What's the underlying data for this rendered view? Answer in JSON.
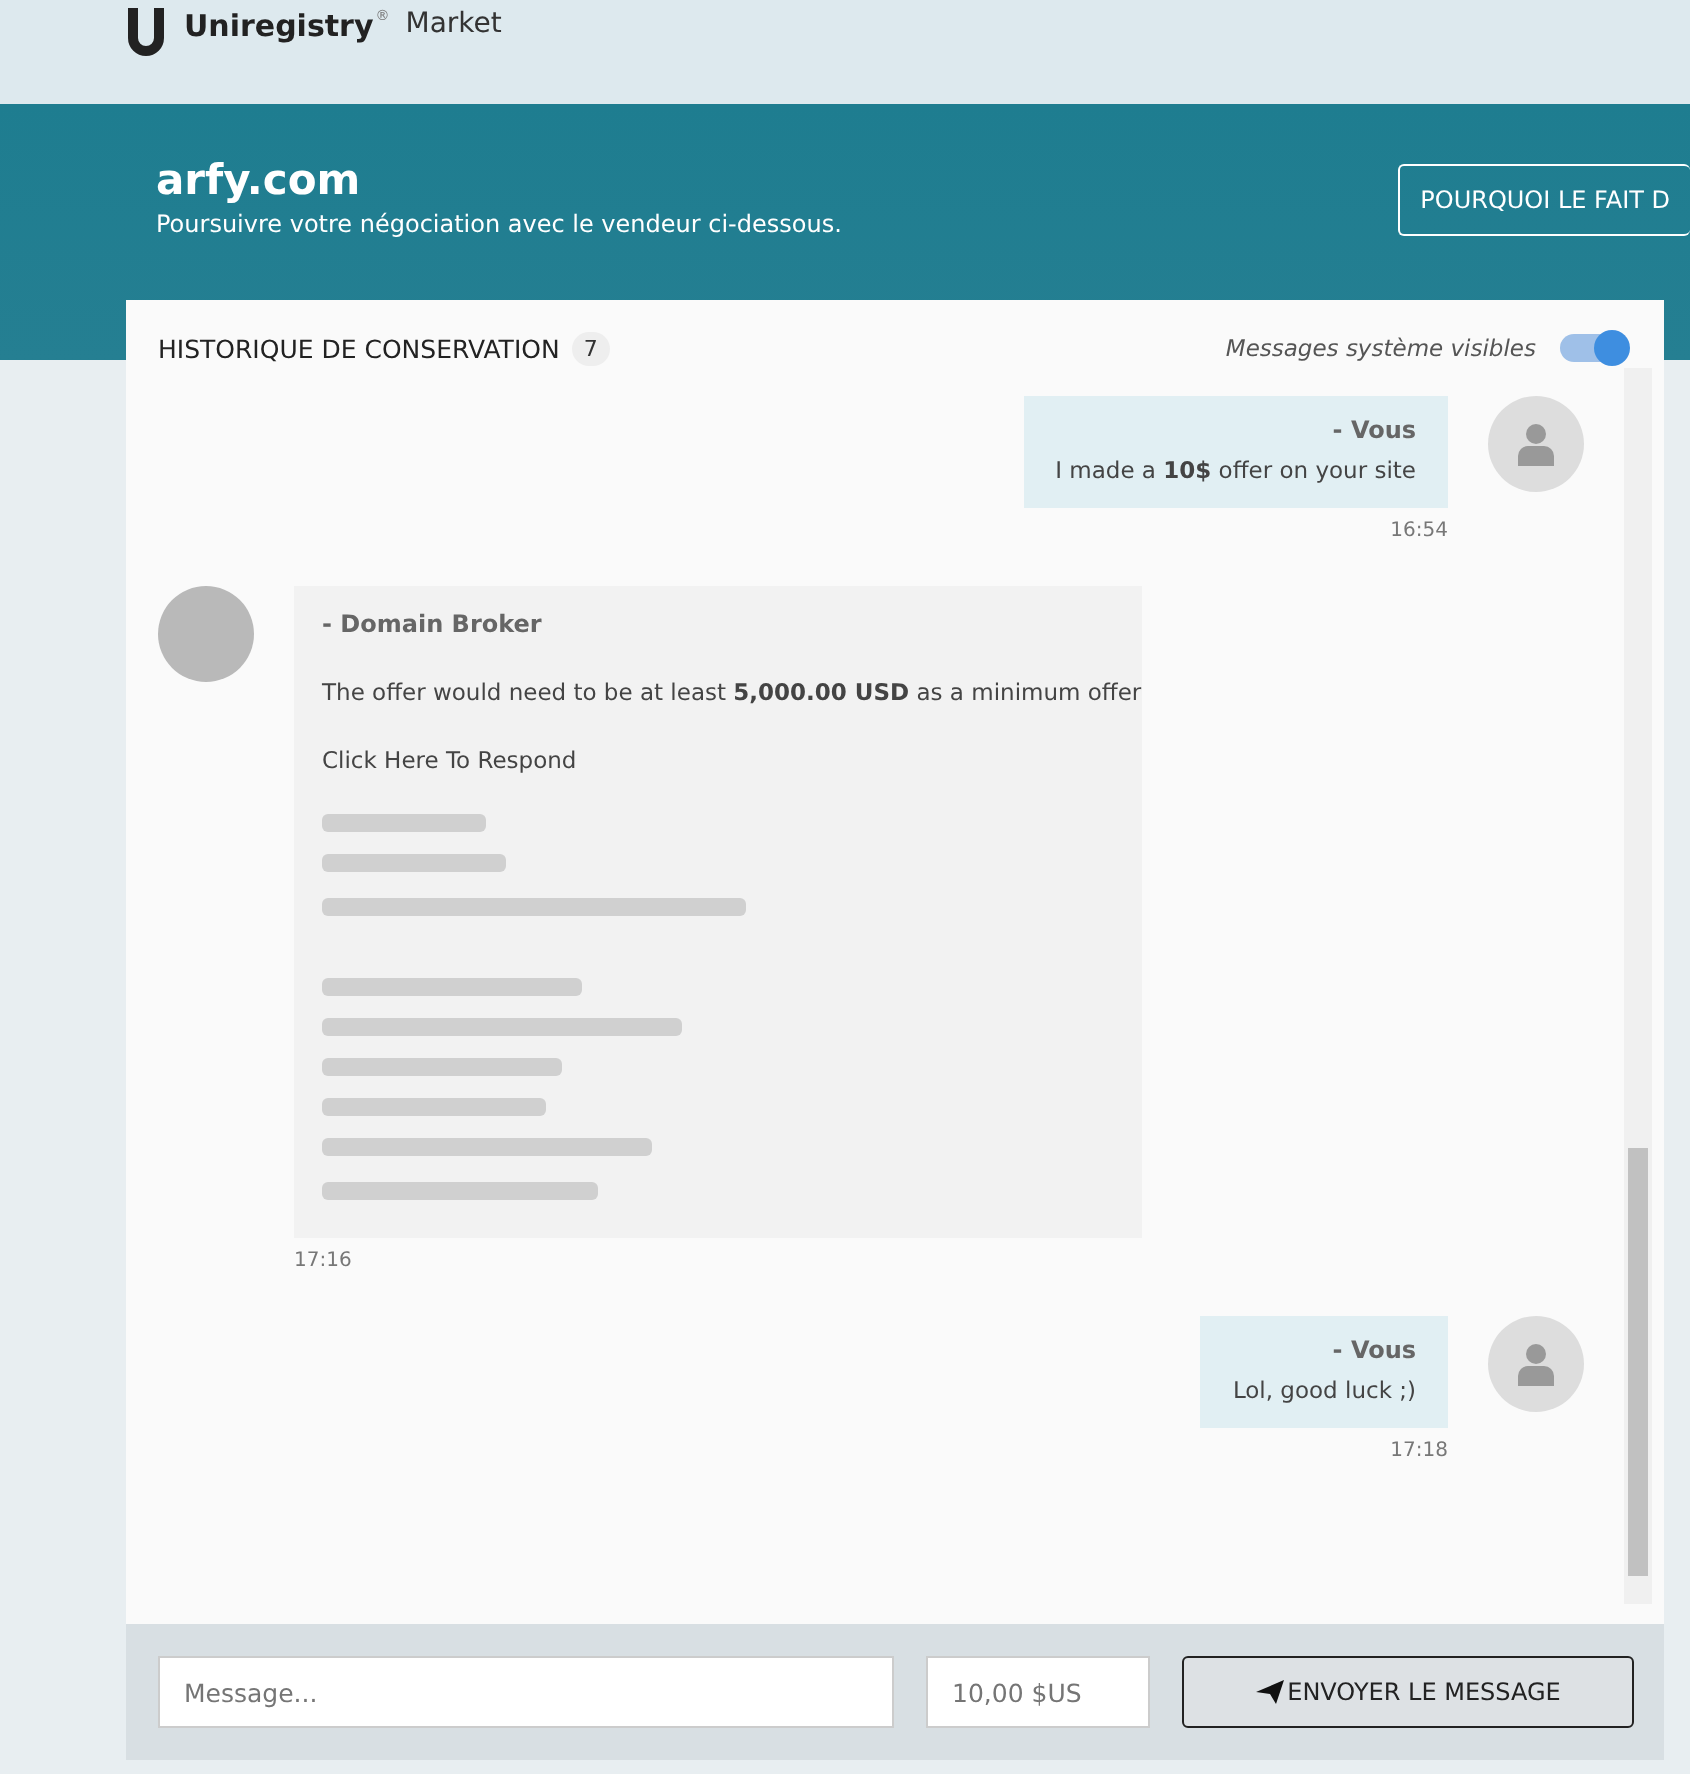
{
  "header": {
    "brand": "Uniregistry",
    "brand_mark": "®",
    "product": "Market"
  },
  "banner": {
    "domain": "arfy.com",
    "subtitle": "Poursuivre votre négociation avec le vendeur ci-dessous.",
    "button": "POURQUOI LE FAIT D"
  },
  "conversation": {
    "title": "HISTORIQUE DE CONSERVATION",
    "count": "7",
    "toggle": {
      "label": "Messages système visibles",
      "on": true
    },
    "messages": [
      {
        "kind": "sent",
        "author": "- Vous",
        "lines": [
          "I made a **10$** offer on your site"
        ],
        "time": "16:54"
      },
      {
        "kind": "received",
        "author": "- Domain Broker",
        "lines": [
          "The offer would need to be at least **5,000.00 USD** as a minimum offer",
          "Click Here To Respond"
        ],
        "time": "17:16"
      },
      {
        "kind": "sent",
        "author": "- Vous",
        "lines": [
          "Lol, good luck ;)"
        ],
        "time": "17:18"
      }
    ]
  },
  "composer": {
    "message_placeholder": "Message...",
    "amount_placeholder": "10,00 $US",
    "send": "ENVOYER LE MESSAGE"
  }
}
